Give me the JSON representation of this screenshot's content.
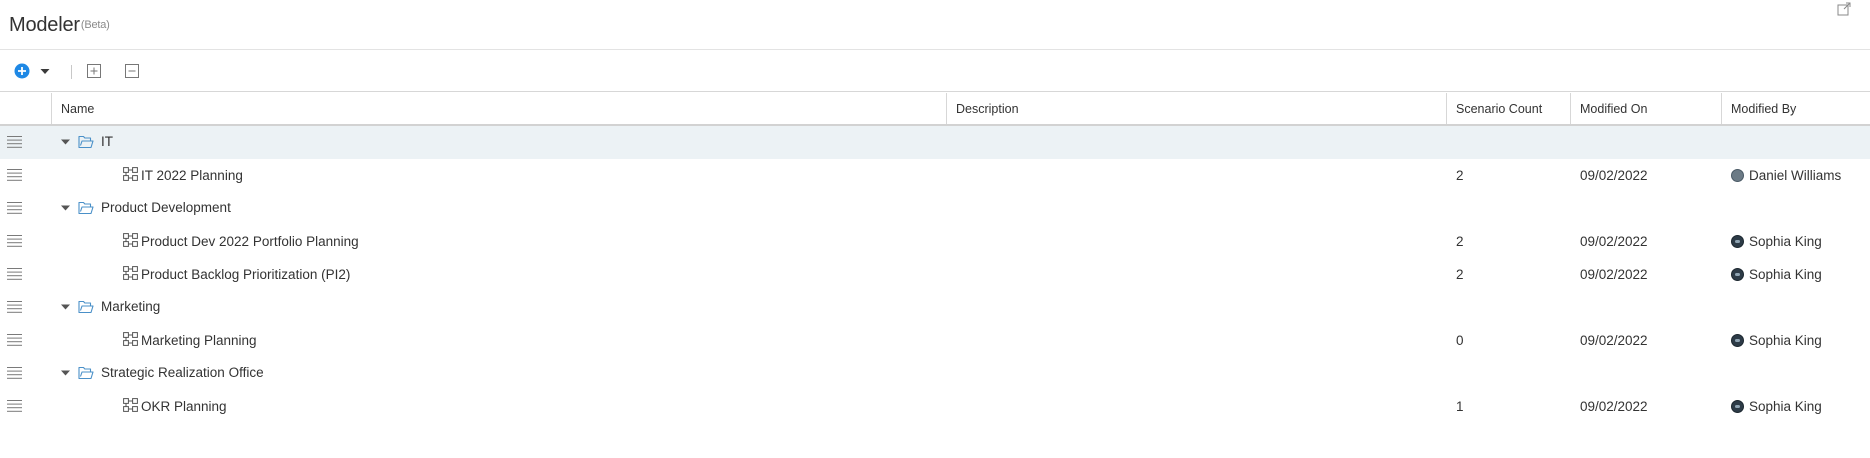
{
  "app": {
    "title": "Modeler",
    "beta": "(Beta)"
  },
  "toolbar": {
    "add_icon": "plus-circle-icon",
    "dropdown_icon": "caret-down-icon",
    "expand_all_icon": "expand-all-icon",
    "collapse_all_icon": "collapse-all-icon"
  },
  "columns": {
    "name": "Name",
    "description": "Description",
    "scenario_count": "Scenario Count",
    "modified_on": "Modified On",
    "modified_by": "Modified By"
  },
  "rows": [
    {
      "type": "folder",
      "name": "IT",
      "selected": true
    },
    {
      "type": "model",
      "name": "IT 2022 Planning",
      "description": "",
      "scenario_count": "2",
      "modified_on": "09/02/2022",
      "modified_by": "Daniel Williams"
    },
    {
      "type": "folder",
      "name": "Product Development"
    },
    {
      "type": "model",
      "name": "Product Dev 2022 Portfolio Planning",
      "description": "",
      "scenario_count": "2",
      "modified_on": "09/02/2022",
      "modified_by": "Sophia King"
    },
    {
      "type": "model",
      "name": "Product Backlog Prioritization (PI2)",
      "description": "",
      "scenario_count": "2",
      "modified_on": "09/02/2022",
      "modified_by": "Sophia King"
    },
    {
      "type": "folder",
      "name": "Marketing"
    },
    {
      "type": "model",
      "name": "Marketing Planning",
      "description": "",
      "scenario_count": "0",
      "modified_on": "09/02/2022",
      "modified_by": "Sophia King"
    },
    {
      "type": "folder",
      "name": "Strategic Realization Office"
    },
    {
      "type": "model",
      "name": "OKR Planning",
      "description": "",
      "scenario_count": "1",
      "modified_on": "09/02/2022",
      "modified_by": "Sophia King"
    }
  ]
}
